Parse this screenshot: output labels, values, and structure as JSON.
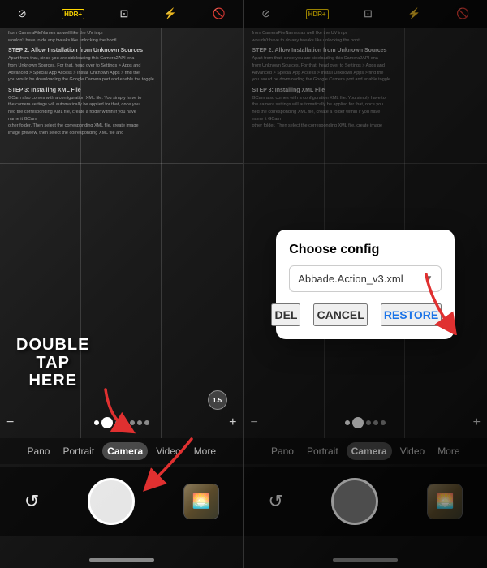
{
  "leftPanel": {
    "toolbar": {
      "icons": [
        "timer-off-icon",
        "hdr-plus-icon",
        "panorama-off-icon",
        "flash-auto-icon",
        "flash-off-icon"
      ]
    },
    "hdrLabel": "HDR+",
    "docLines": [
      "from CameraFileNames as well like the UV impr",
      "wouldn't have to do any tweaks like unlocking the bootl",
      "STEP 2: Allow Installation from Unknown Sources ena",
      "Apart from that, since you are sideloading this Camera2AP",
      "from Unknown Sources. For that, head over to Settings > Ap",
      "Advanced > Special App Access > Install Unknown Apps > en",
      "you would be downloading the Google Camera port and enable",
      "STEP 3: Installing XML File",
      "GCam also comes with a configuration XML file. You simply",
      "the camera settings will automatically be applied for that,",
      "hed the corresponding XML file, create a folder within if",
      "name it GCam",
      "other folder. Then select the corresponding XML file, create",
      "image preview, then select the corresponding XML file and"
    ],
    "doubleTapText": "DOUBLE\nTAP\nHERE",
    "versionBadge": "1.5",
    "modes": [
      "Pano",
      "Portrait",
      "Camera",
      "Video",
      "More"
    ],
    "activeMode": "Camera",
    "controls": {
      "minus": "−",
      "plus": "+"
    }
  },
  "rightPanel": {
    "toolbar": {
      "icons": [
        "timer-off-icon",
        "hdr-plus-icon",
        "panorama-off-icon",
        "flash-auto-icon",
        "flash-off-icon"
      ]
    },
    "hdrLabel": "HDR+",
    "modes": [
      "Pano",
      "Portrait",
      "Camera",
      "Video",
      "More"
    ],
    "activeMode": "Camera",
    "dialog": {
      "title": "Choose config",
      "selectedOption": "Abbade.Action_v3.xml",
      "buttons": {
        "del": "DEL",
        "cancel": "CANCEL",
        "restore": "RESTORE"
      }
    },
    "moreLabel": "More"
  }
}
